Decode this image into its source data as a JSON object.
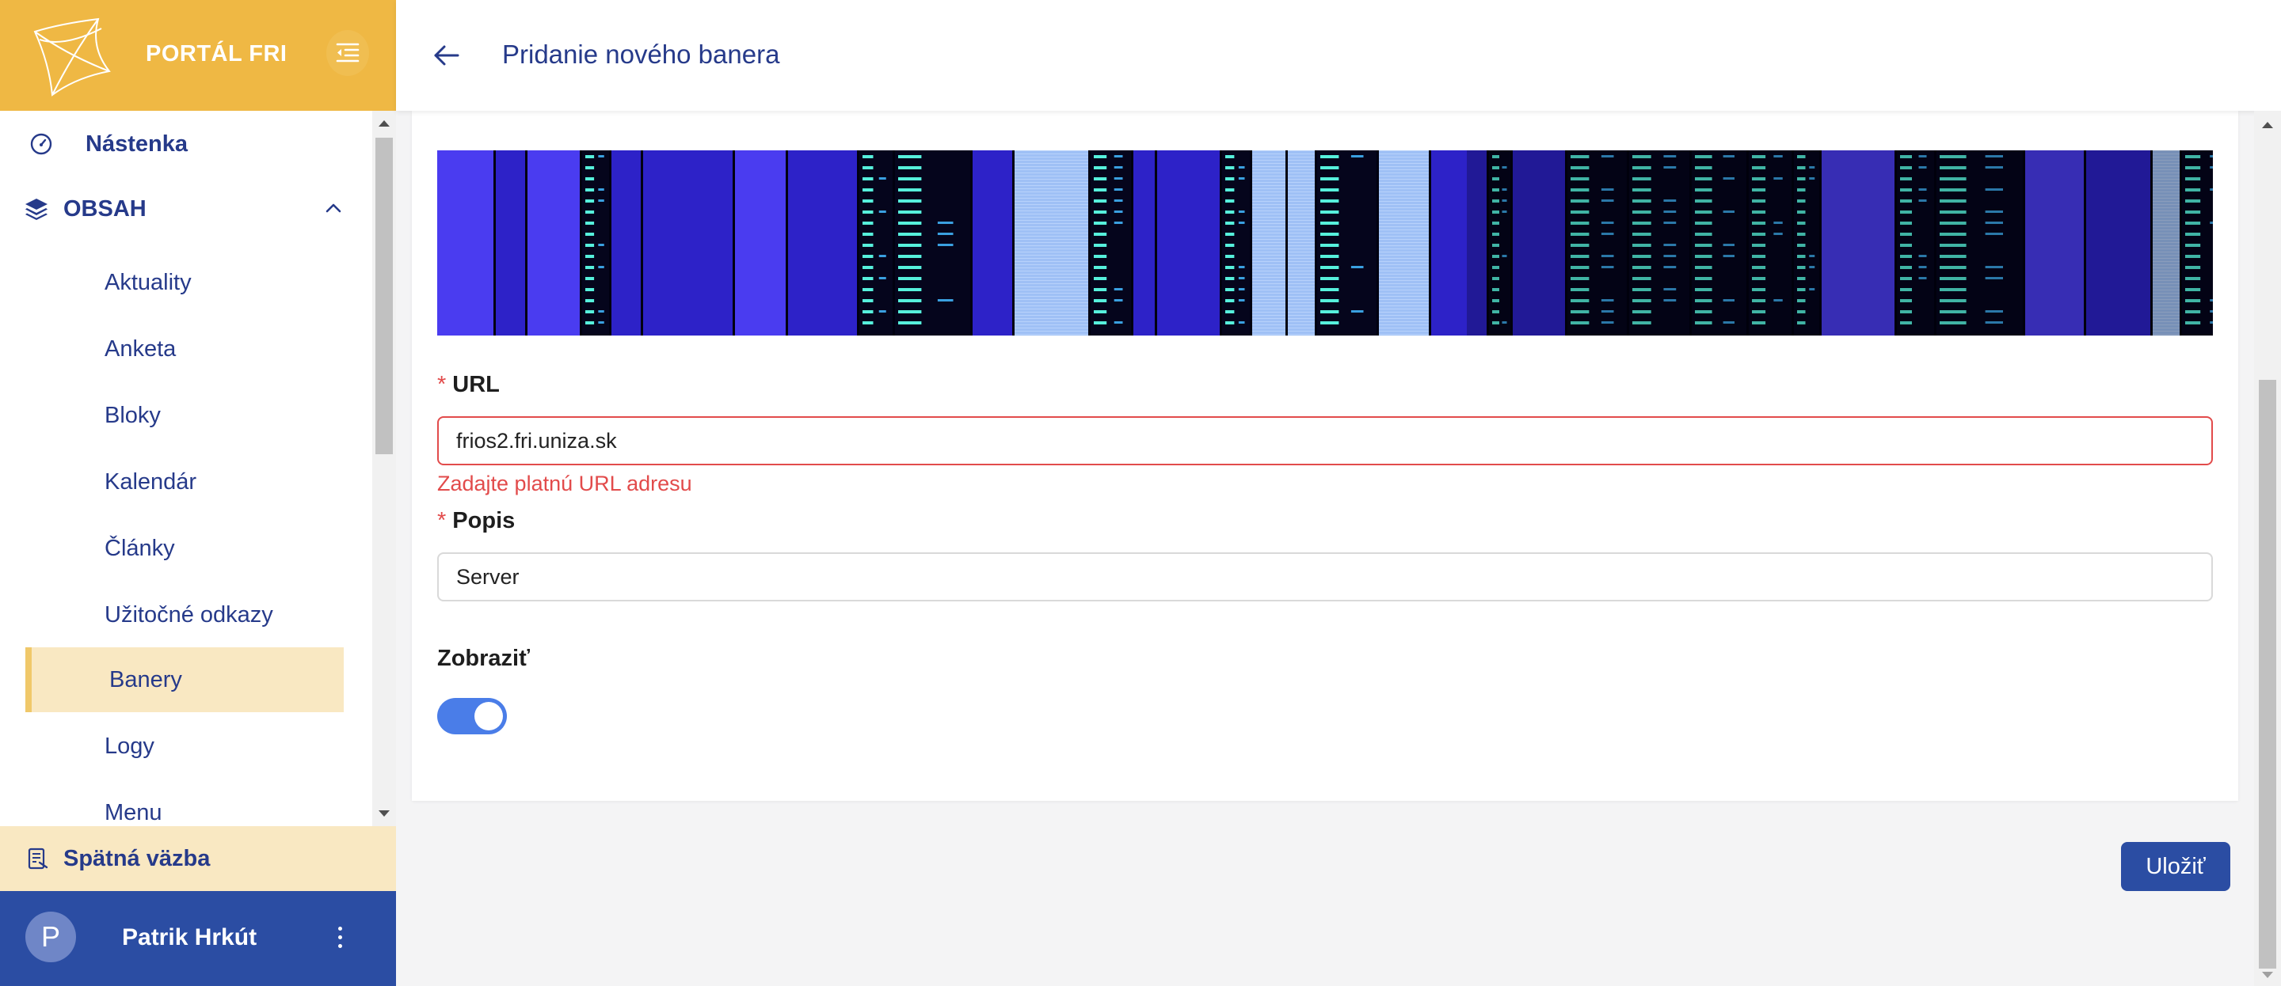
{
  "app": {
    "title": "PORTÁL FRI",
    "brand_color": "#efb844",
    "primary_color": "#2b4da3"
  },
  "sidebar": {
    "dashboard_label": "Nástenka",
    "section_label": "OBSAH",
    "items": [
      {
        "label": "Aktuality"
      },
      {
        "label": "Anketa"
      },
      {
        "label": "Bloky"
      },
      {
        "label": "Kalendár"
      },
      {
        "label": "Články"
      },
      {
        "label": "Užitočné odkazy"
      },
      {
        "label": "Banery",
        "active": true
      },
      {
        "label": "Logy"
      },
      {
        "label": "Menu"
      }
    ],
    "feedback_label": "Spätná väzba"
  },
  "user": {
    "initial": "P",
    "name": "Patrik Hrkút"
  },
  "header": {
    "title": "Pridanie nového banera"
  },
  "form": {
    "url_label": "URL",
    "url_value": "frios2.fri.uniza.sk",
    "url_error": "Zadajte platnú URL adresu",
    "description_label": "Popis",
    "description_value": "Server",
    "show_label": "Zobraziť",
    "show_enabled": true,
    "required_mark": "*"
  },
  "actions": {
    "save_label": "Uložiť"
  }
}
